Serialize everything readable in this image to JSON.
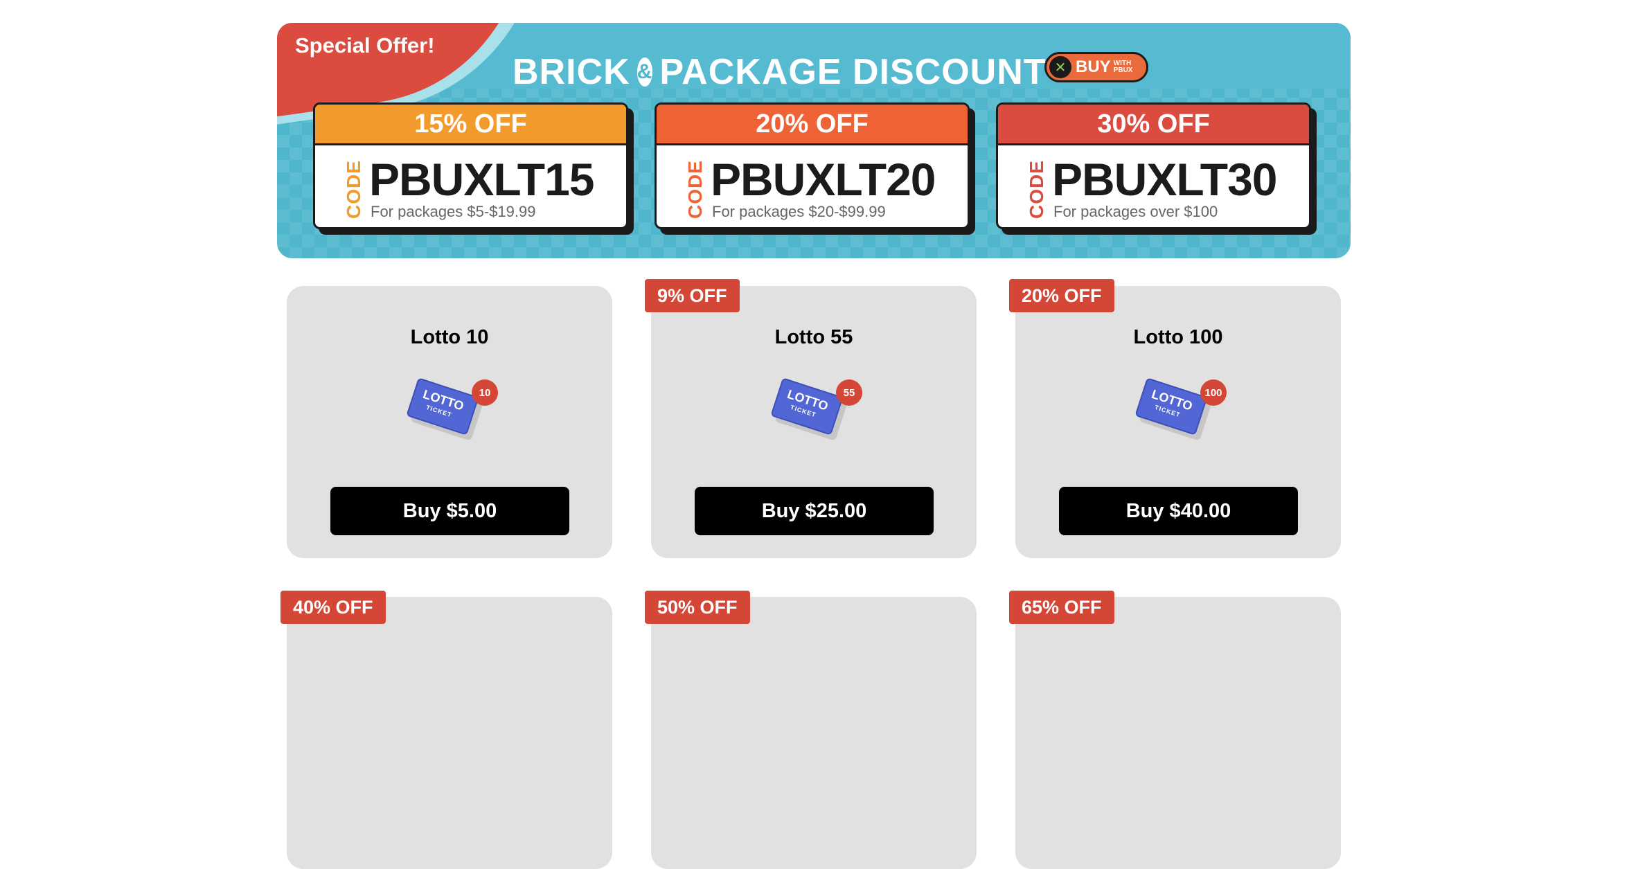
{
  "banner": {
    "ribbon": "Special Offer!",
    "title_left": "BRICK",
    "title_amp": "&",
    "title_right": "PACKAGE DISCOUNT",
    "badge": {
      "buy": "BUY",
      "with": "WITH",
      "pbux": "PBUX",
      "icon": "pbux-logo-icon"
    },
    "colors": {
      "background": "#4fb6cc",
      "ribbon": "#db4b3f"
    },
    "coupons": [
      {
        "off": "15% OFF",
        "code_label": "CODE",
        "code": "PBUXLT15",
        "range": "For packages $5-$19.99",
        "color": "#f29b2c"
      },
      {
        "off": "20% OFF",
        "code_label": "CODE",
        "code": "PBUXLT20",
        "range": "For packages $20-$99.99",
        "color": "#ef6236"
      },
      {
        "off": "30% OFF",
        "code_label": "CODE",
        "code": "PBUXLT30",
        "range": "For packages over $100",
        "color": "#db4b3f"
      }
    ]
  },
  "products": [
    {
      "name": "Lotto 10",
      "badge": "10",
      "ticket_line1": "LOTTO",
      "ticket_line2": "TICKET",
      "button": "Buy $5.00",
      "discount": ""
    },
    {
      "name": "Lotto 55",
      "badge": "55",
      "ticket_line1": "LOTTO",
      "ticket_line2": "TICKET",
      "button": "Buy $25.00",
      "discount": "9% OFF"
    },
    {
      "name": "Lotto 100",
      "badge": "100",
      "ticket_line1": "LOTTO",
      "ticket_line2": "TICKET",
      "button": "Buy $40.00",
      "discount": "20% OFF"
    }
  ],
  "next_row_discounts": [
    "40% OFF",
    "50% OFF",
    "65% OFF"
  ],
  "colors": {
    "card": "#e1e1e1",
    "discount_tag": "#d44636",
    "button": "#000000"
  }
}
